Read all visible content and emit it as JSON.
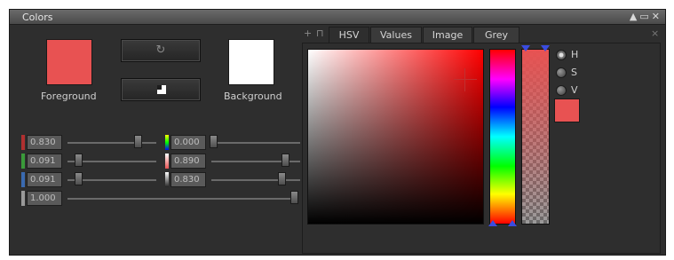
{
  "window": {
    "title": "Colors",
    "controls": [
      "▲",
      "▭",
      "✕"
    ]
  },
  "colors": {
    "foreground": "#e85252",
    "background": "#ffffff",
    "red_channel": "#b03030",
    "green_channel": "#3a9a3a",
    "blue_channel": "#3a6ab0",
    "alpha_channel": "#9a9a9a"
  },
  "left": {
    "foreground_label": "Foreground",
    "background_label": "Background",
    "reset_icon": "refresh-icon",
    "swap_icon": "swap-icon",
    "rgb_fields": [
      {
        "channel": "red",
        "value": "0.830",
        "slider": 0.83
      },
      {
        "channel": "green",
        "value": "0.091",
        "slider": 0.091
      },
      {
        "channel": "blue",
        "value": "0.091",
        "slider": 0.091
      },
      {
        "channel": "alpha",
        "value": "1.000",
        "slider": 1.0
      }
    ],
    "hsv_fields": [
      {
        "channel": "hue",
        "value": "0.000",
        "slider": 0.0
      },
      {
        "channel": "saturation",
        "value": "0.890",
        "slider": 0.89
      },
      {
        "channel": "value",
        "value": "0.830",
        "slider": 0.83
      }
    ]
  },
  "tabs": {
    "pin_icons": [
      "+",
      "⊓"
    ],
    "items": [
      "HSV",
      "Values",
      "Image",
      "Grey"
    ],
    "active": "HSV",
    "close": "×"
  },
  "picker": {
    "radio_options": [
      "H",
      "S",
      "V"
    ],
    "selected_mode": "H"
  }
}
